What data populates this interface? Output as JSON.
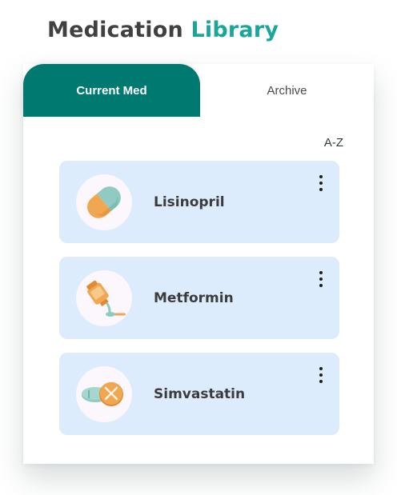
{
  "header": {
    "title_part1": "Medication",
    "title_part2": "Library"
  },
  "tabs": [
    {
      "label": "Current Med",
      "active": true
    },
    {
      "label": "Archive",
      "active": false
    }
  ],
  "sort": {
    "label": "A-Z"
  },
  "medications": [
    {
      "name": "Lisinopril",
      "icon": "capsule-icon"
    },
    {
      "name": "Metformin",
      "icon": "syrup-bottle-spoon-icon"
    },
    {
      "name": "Simvastatin",
      "icon": "tablets-icon"
    }
  ],
  "colors": {
    "accent": "#1aa79a",
    "tab_active": "#007a70",
    "item_bg": "#dcecfd",
    "title_text": "#404040"
  }
}
